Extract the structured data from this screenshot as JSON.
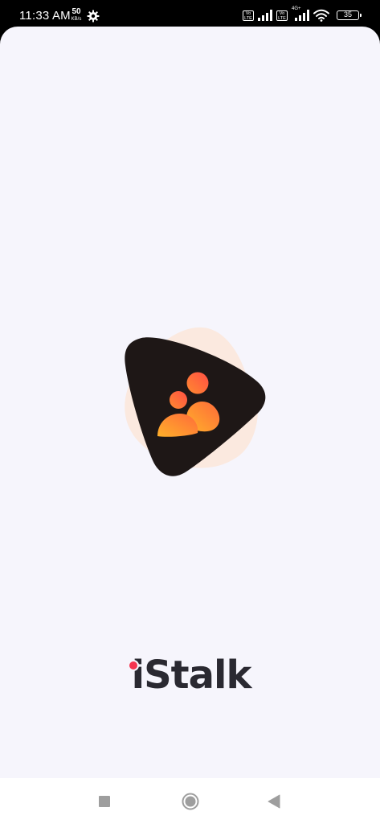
{
  "status_bar": {
    "time": "11:33 AM",
    "net_speed_value": "50",
    "net_speed_unit": "KB/s",
    "volte_1": "Vo LTE",
    "volte_2": "Vo LTE",
    "network_type": "4G+",
    "battery": "35"
  },
  "app": {
    "name": "iStalk"
  },
  "colors": {
    "background": "#f6f5fc",
    "logo_dark": "#1e1716",
    "logo_orange": "#ff6a3a",
    "logo_yellow": "#ffb12a",
    "wordmark": "#2a2931",
    "accent_red": "#f5344f"
  },
  "icons": {
    "settings": "gear-icon",
    "wifi": "wifi-icon",
    "signal": "signal-icon",
    "battery": "battery-icon",
    "recents": "square-icon",
    "home": "circle-icon",
    "back": "triangle-back-icon"
  }
}
